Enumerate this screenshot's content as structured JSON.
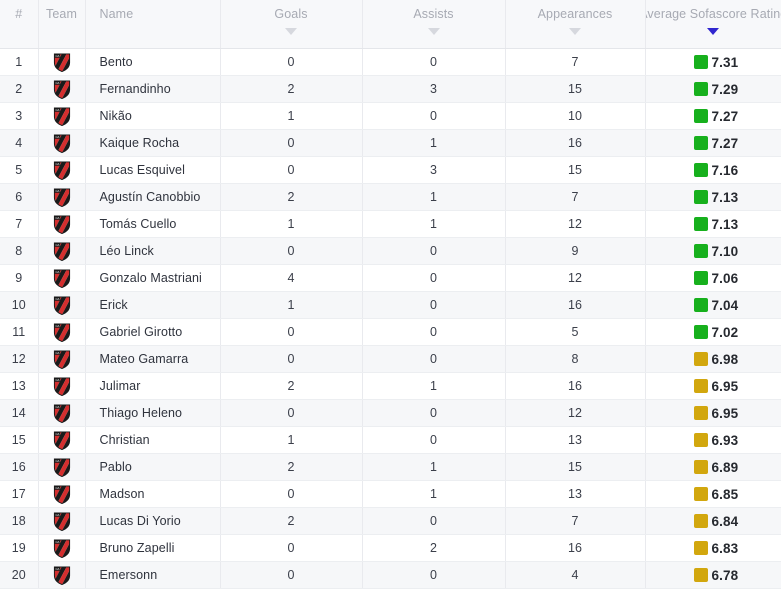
{
  "table": {
    "columns": [
      {
        "key": "rank",
        "label": "#",
        "align": "center",
        "sortable": true,
        "sorted": false,
        "caret": false
      },
      {
        "key": "team",
        "label": "Team",
        "align": "center",
        "sortable": false,
        "sorted": false,
        "caret": false
      },
      {
        "key": "name",
        "label": "Name",
        "align": "left",
        "sortable": false,
        "sorted": false,
        "caret": false
      },
      {
        "key": "goals",
        "label": "Goals",
        "align": "center",
        "sortable": true,
        "sorted": false,
        "caret": true
      },
      {
        "key": "assists",
        "label": "Assists",
        "align": "center",
        "sortable": true,
        "sorted": false,
        "caret": true
      },
      {
        "key": "appearances",
        "label": "Appearances",
        "align": "center",
        "sortable": true,
        "sorted": false,
        "caret": true
      },
      {
        "key": "rating",
        "label": "Average Sofascore Rating",
        "align": "center",
        "sortable": true,
        "sorted": true,
        "caret": true
      }
    ],
    "sorted_by": "Average Sofascore Rating",
    "sort_direction": "descending",
    "team_crest_name": "athletico-paranaense-crest",
    "colors": {
      "rating_green": "#17b01d",
      "rating_yellow": "#d2a70e",
      "sort_active": "#3026cf",
      "header_text": "#a7aab3",
      "row_odd": "#ffffff",
      "row_even": "#f6f7f9",
      "border": "#e9eaee"
    },
    "rows": [
      {
        "rank": "1",
        "name": "Bento",
        "goals": "0",
        "assists": "0",
        "appearances": "7",
        "rating": "7.31",
        "rating_color": "green"
      },
      {
        "rank": "2",
        "name": "Fernandinho",
        "goals": "2",
        "assists": "3",
        "appearances": "15",
        "rating": "7.29",
        "rating_color": "green"
      },
      {
        "rank": "3",
        "name": "Nikão",
        "goals": "1",
        "assists": "0",
        "appearances": "10",
        "rating": "7.27",
        "rating_color": "green"
      },
      {
        "rank": "4",
        "name": "Kaique Rocha",
        "goals": "0",
        "assists": "1",
        "appearances": "16",
        "rating": "7.27",
        "rating_color": "green"
      },
      {
        "rank": "5",
        "name": "Lucas Esquivel",
        "goals": "0",
        "assists": "3",
        "appearances": "15",
        "rating": "7.16",
        "rating_color": "green"
      },
      {
        "rank": "6",
        "name": "Agustín Canobbio",
        "goals": "2",
        "assists": "1",
        "appearances": "7",
        "rating": "7.13",
        "rating_color": "green"
      },
      {
        "rank": "7",
        "name": "Tomás Cuello",
        "goals": "1",
        "assists": "1",
        "appearances": "12",
        "rating": "7.13",
        "rating_color": "green"
      },
      {
        "rank": "8",
        "name": "Léo Linck",
        "goals": "0",
        "assists": "0",
        "appearances": "9",
        "rating": "7.10",
        "rating_color": "green"
      },
      {
        "rank": "9",
        "name": "Gonzalo Mastriani",
        "goals": "4",
        "assists": "0",
        "appearances": "12",
        "rating": "7.06",
        "rating_color": "green"
      },
      {
        "rank": "10",
        "name": "Erick",
        "goals": "1",
        "assists": "0",
        "appearances": "16",
        "rating": "7.04",
        "rating_color": "green"
      },
      {
        "rank": "11",
        "name": "Gabriel Girotto",
        "goals": "0",
        "assists": "0",
        "appearances": "5",
        "rating": "7.02",
        "rating_color": "green"
      },
      {
        "rank": "12",
        "name": "Mateo Gamarra",
        "goals": "0",
        "assists": "0",
        "appearances": "8",
        "rating": "6.98",
        "rating_color": "yellow"
      },
      {
        "rank": "13",
        "name": "Julimar",
        "goals": "2",
        "assists": "1",
        "appearances": "16",
        "rating": "6.95",
        "rating_color": "yellow"
      },
      {
        "rank": "14",
        "name": "Thiago Heleno",
        "goals": "0",
        "assists": "0",
        "appearances": "12",
        "rating": "6.95",
        "rating_color": "yellow"
      },
      {
        "rank": "15",
        "name": "Christian",
        "goals": "1",
        "assists": "0",
        "appearances": "13",
        "rating": "6.93",
        "rating_color": "yellow"
      },
      {
        "rank": "16",
        "name": "Pablo",
        "goals": "2",
        "assists": "1",
        "appearances": "15",
        "rating": "6.89",
        "rating_color": "yellow"
      },
      {
        "rank": "17",
        "name": "Madson",
        "goals": "0",
        "assists": "1",
        "appearances": "13",
        "rating": "6.85",
        "rating_color": "yellow"
      },
      {
        "rank": "18",
        "name": "Lucas Di Yorio",
        "goals": "2",
        "assists": "0",
        "appearances": "7",
        "rating": "6.84",
        "rating_color": "yellow"
      },
      {
        "rank": "19",
        "name": "Bruno Zapelli",
        "goals": "0",
        "assists": "2",
        "appearances": "16",
        "rating": "6.83",
        "rating_color": "yellow"
      },
      {
        "rank": "20",
        "name": "Emersonn",
        "goals": "0",
        "assists": "0",
        "appearances": "4",
        "rating": "6.78",
        "rating_color": "yellow"
      }
    ]
  }
}
